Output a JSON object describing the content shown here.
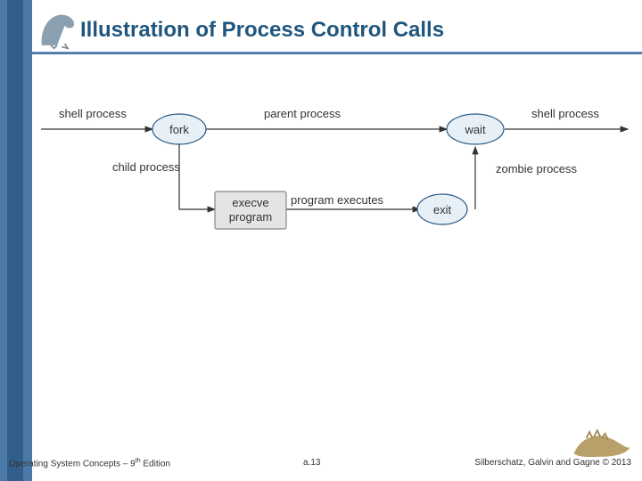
{
  "title": "Illustration of Process Control Calls",
  "footer": {
    "book_prefix": "Operating System Concepts – 9",
    "book_suffix": " Edition",
    "book_sup": "th",
    "page": "a.13",
    "copyright": "Silberschatz, Galvin and Gagne © 2013"
  },
  "diagram": {
    "nodes": {
      "fork": "fork",
      "wait": "wait",
      "exit": "exit",
      "execve_l1": "execve",
      "execve_l2": "program"
    },
    "labels": {
      "shell_left": "shell process",
      "parent": "parent process",
      "shell_right": "shell process",
      "child": "child process",
      "prog_exec": "program executes",
      "zombie": "zombie process"
    }
  },
  "chart_data": {
    "type": "diagram",
    "title": "Illustration of Process Control Calls",
    "nodes": [
      {
        "id": "fork",
        "label": "fork",
        "shape": "ellipse"
      },
      {
        "id": "wait",
        "label": "wait",
        "shape": "ellipse"
      },
      {
        "id": "exit",
        "label": "exit",
        "shape": "ellipse"
      },
      {
        "id": "execve",
        "label": "execve program",
        "shape": "rect"
      }
    ],
    "edges": [
      {
        "from": "start",
        "to": "fork",
        "label": "shell process"
      },
      {
        "from": "fork",
        "to": "wait",
        "label": "parent process"
      },
      {
        "from": "wait",
        "to": "end",
        "label": "shell process"
      },
      {
        "from": "fork",
        "to": "execve",
        "label": "child process"
      },
      {
        "from": "execve",
        "to": "exit",
        "label": "program executes"
      },
      {
        "from": "exit",
        "to": "wait",
        "label": "zombie process"
      }
    ]
  }
}
